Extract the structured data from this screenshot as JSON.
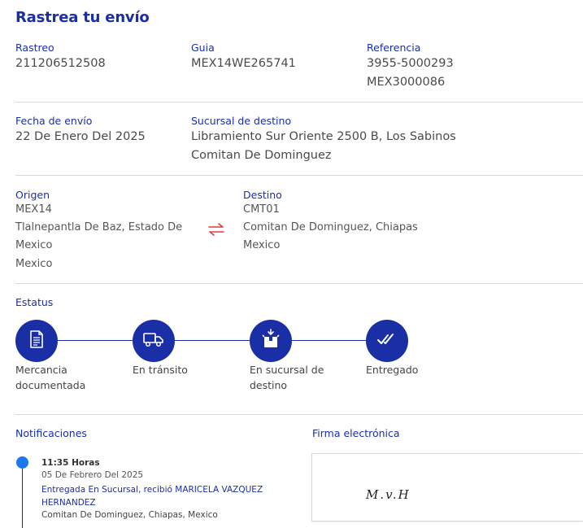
{
  "page_title": "Rastrea tu envío",
  "info": {
    "rastreo_label": "Rastreo",
    "rastreo_value": "211206512508",
    "guia_label": "Guia",
    "guia_value": "MEX14WE265741",
    "referencia_label": "Referencia",
    "referencia_lines": [
      "3955-5000293",
      "MEX3000086"
    ],
    "fecha_label": "Fecha de envío",
    "fecha_value": "22 De Enero Del 2025",
    "sucursal_label": "Sucursal de destino",
    "sucursal_lines": [
      "Libramiento Sur Oriente 2500 B, Los Sabinos",
      "Comitan De Dominguez"
    ]
  },
  "route": {
    "origen_label": "Origen",
    "origen_lines": [
      "MEX14",
      "Tlalnepantla De Baz, Estado De",
      "Mexico",
      "Mexico"
    ],
    "destino_label": "Destino",
    "destino_lines": [
      "CMT01",
      "Comitan De Dominguez, Chiapas",
      "Mexico"
    ],
    "swap_icon": "swap-arrows-icon"
  },
  "status": {
    "label": "Estatus",
    "steps": [
      {
        "icon": "document-icon",
        "lines": [
          "Mercancia",
          "documentada"
        ]
      },
      {
        "icon": "truck-icon",
        "lines": [
          "En tránsito"
        ]
      },
      {
        "icon": "package-icon",
        "lines": [
          "En sucursal de",
          "destino"
        ]
      },
      {
        "icon": "double-check-icon",
        "lines": [
          "Entregado"
        ]
      }
    ],
    "color": "#1a2fa6"
  },
  "notifications": {
    "label": "Notificaciones",
    "items": [
      {
        "time": "11:35 Horas",
        "date": "05 De Febrero Del 2025",
        "message": "Entregada En Sucursal, recibió MARICELA VAZQUEZ HERNANDEZ",
        "location": "Comitan De Dominguez, Chiapas, Mexico"
      }
    ],
    "dot_color": "#1a78f0"
  },
  "signature": {
    "label": "Firma electrónica",
    "text": "M.v.H"
  }
}
